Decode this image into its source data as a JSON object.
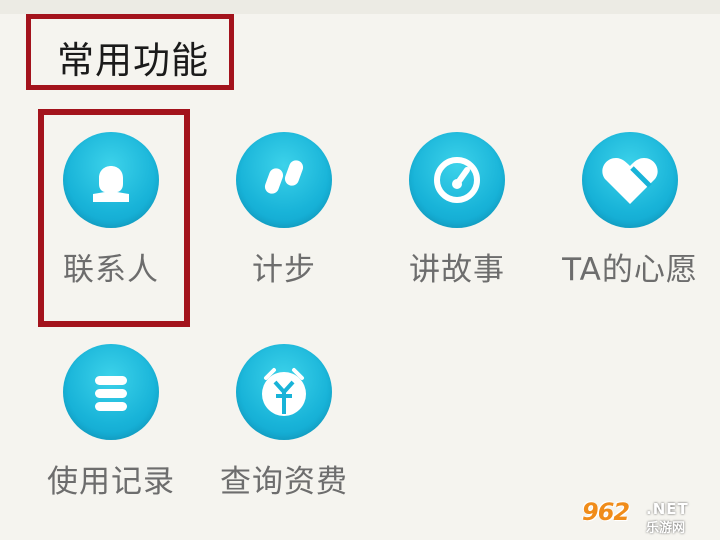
{
  "section": {
    "title": "常用功能"
  },
  "items": [
    {
      "label": "联系人",
      "icon": "contact-person-icon"
    },
    {
      "label": "计步",
      "icon": "footsteps-icon"
    },
    {
      "label": "讲故事",
      "icon": "story-record-icon"
    },
    {
      "label": "TA的心愿",
      "icon": "heart-wish-icon"
    },
    {
      "label": "使用记录",
      "icon": "usage-record-icon"
    },
    {
      "label": "查询资费",
      "icon": "fee-query-icon"
    }
  ],
  "watermark": {
    "number": "962",
    "domain": ".NET",
    "site": "乐游网"
  },
  "colors": {
    "accent": "#18b3d8",
    "highlight": "#a3131c",
    "label": "#6d6d6d"
  }
}
